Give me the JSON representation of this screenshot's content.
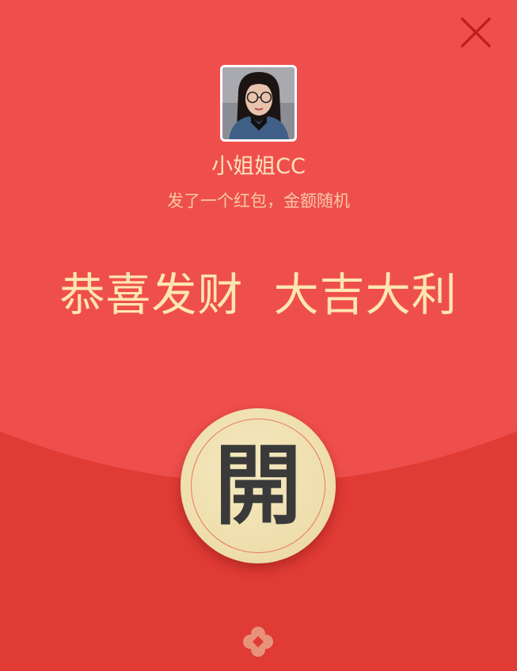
{
  "close_icon": "close-icon",
  "sender": {
    "name": "小姐姐CC",
    "subtitle": "发了一个红包，金额随机"
  },
  "greeting": "恭喜发财  大吉大利",
  "open_button": {
    "label": "開"
  },
  "bottom_icon": "red-packet-logo-icon",
  "colors": {
    "top_flap": "#ef4f4c",
    "bottom": "#e03b35",
    "gold_text": "#fde6b2",
    "button_face": "#efdfae",
    "close_x": "#c0201a"
  }
}
